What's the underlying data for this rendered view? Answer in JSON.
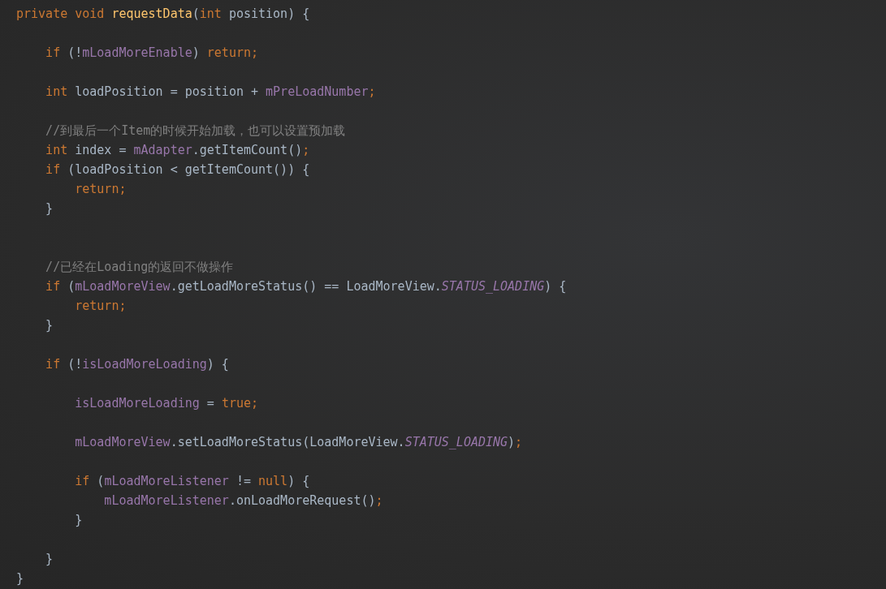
{
  "code_lines": [
    {
      "kind": "code",
      "tokens": [
        {
          "kind": "keyword",
          "text": "private void "
        },
        {
          "kind": "method",
          "text": "requestData"
        },
        {
          "kind": "plain",
          "text": "("
        },
        {
          "kind": "keyword",
          "text": "int"
        },
        {
          "kind": "plain",
          "text": " position) {"
        }
      ]
    },
    {
      "kind": "blank"
    },
    {
      "kind": "code",
      "tokens": [
        {
          "kind": "keyword",
          "text": "    if"
        },
        {
          "kind": "plain",
          "text": " (!"
        },
        {
          "kind": "field",
          "text": "mLoadMoreEnable"
        },
        {
          "kind": "plain",
          "text": ") "
        },
        {
          "kind": "keyword",
          "text": "return;"
        }
      ]
    },
    {
      "kind": "blank"
    },
    {
      "kind": "code",
      "tokens": [
        {
          "kind": "keyword",
          "text": "    int"
        },
        {
          "kind": "plain",
          "text": " loadPosition = position + "
        },
        {
          "kind": "field",
          "text": "mPreLoadNumber"
        },
        {
          "kind": "keyword",
          "text": ";"
        }
      ]
    },
    {
      "kind": "blank"
    },
    {
      "kind": "code",
      "tokens": [
        {
          "kind": "comment",
          "text": "    //到最后一个Item的时候开始加载，也可以设置预加载"
        }
      ]
    },
    {
      "kind": "code",
      "tokens": [
        {
          "kind": "keyword",
          "text": "    int"
        },
        {
          "kind": "plain",
          "text": " index = "
        },
        {
          "kind": "field",
          "text": "mAdapter"
        },
        {
          "kind": "plain",
          "text": ".getItemCount()"
        },
        {
          "kind": "keyword",
          "text": ";"
        }
      ]
    },
    {
      "kind": "code",
      "tokens": [
        {
          "kind": "keyword",
          "text": "    if"
        },
        {
          "kind": "plain",
          "text": " (loadPosition < getItemCount()) {"
        }
      ]
    },
    {
      "kind": "code",
      "tokens": [
        {
          "kind": "keyword",
          "text": "        return;"
        }
      ]
    },
    {
      "kind": "code",
      "tokens": [
        {
          "kind": "plain",
          "text": "    }"
        }
      ]
    },
    {
      "kind": "blank"
    },
    {
      "kind": "blank"
    },
    {
      "kind": "code",
      "tokens": [
        {
          "kind": "comment",
          "text": "    //已经在Loading的返回不做操作"
        }
      ]
    },
    {
      "kind": "code",
      "tokens": [
        {
          "kind": "keyword",
          "text": "    if"
        },
        {
          "kind": "plain",
          "text": " ("
        },
        {
          "kind": "field",
          "text": "mLoadMoreView"
        },
        {
          "kind": "plain",
          "text": ".getLoadMoreStatus() == LoadMoreView."
        },
        {
          "kind": "static",
          "text": "STATUS_LOADING"
        },
        {
          "kind": "plain",
          "text": ") {"
        }
      ]
    },
    {
      "kind": "code",
      "tokens": [
        {
          "kind": "keyword",
          "text": "        return;"
        }
      ]
    },
    {
      "kind": "code",
      "tokens": [
        {
          "kind": "plain",
          "text": "    }"
        }
      ]
    },
    {
      "kind": "blank"
    },
    {
      "kind": "code",
      "tokens": [
        {
          "kind": "keyword",
          "text": "    if"
        },
        {
          "kind": "plain",
          "text": " (!"
        },
        {
          "kind": "field",
          "text": "isLoadMoreLoading"
        },
        {
          "kind": "plain",
          "text": ") {"
        }
      ]
    },
    {
      "kind": "blank"
    },
    {
      "kind": "code",
      "tokens": [
        {
          "kind": "field",
          "text": "        isLoadMoreLoading"
        },
        {
          "kind": "plain",
          "text": " = "
        },
        {
          "kind": "keyword",
          "text": "true;"
        }
      ]
    },
    {
      "kind": "blank"
    },
    {
      "kind": "code",
      "tokens": [
        {
          "kind": "field",
          "text": "        mLoadMoreView"
        },
        {
          "kind": "plain",
          "text": ".setLoadMoreStatus(LoadMoreView."
        },
        {
          "kind": "static",
          "text": "STATUS_LOADING"
        },
        {
          "kind": "plain",
          "text": ")"
        },
        {
          "kind": "keyword",
          "text": ";"
        }
      ]
    },
    {
      "kind": "blank"
    },
    {
      "kind": "code",
      "tokens": [
        {
          "kind": "keyword",
          "text": "        if"
        },
        {
          "kind": "plain",
          "text": " ("
        },
        {
          "kind": "field",
          "text": "mLoadMoreListener"
        },
        {
          "kind": "plain",
          "text": " != "
        },
        {
          "kind": "keyword",
          "text": "null"
        },
        {
          "kind": "plain",
          "text": ") {"
        }
      ]
    },
    {
      "kind": "code",
      "tokens": [
        {
          "kind": "field",
          "text": "            mLoadMoreListener"
        },
        {
          "kind": "plain",
          "text": ".onLoadMoreRequest()"
        },
        {
          "kind": "keyword",
          "text": ";"
        }
      ]
    },
    {
      "kind": "code",
      "tokens": [
        {
          "kind": "plain",
          "text": "        }"
        }
      ]
    },
    {
      "kind": "blank"
    },
    {
      "kind": "code",
      "tokens": [
        {
          "kind": "plain",
          "text": "    }"
        }
      ]
    },
    {
      "kind": "code",
      "tokens": [
        {
          "kind": "plain",
          "text": "}"
        }
      ]
    }
  ]
}
